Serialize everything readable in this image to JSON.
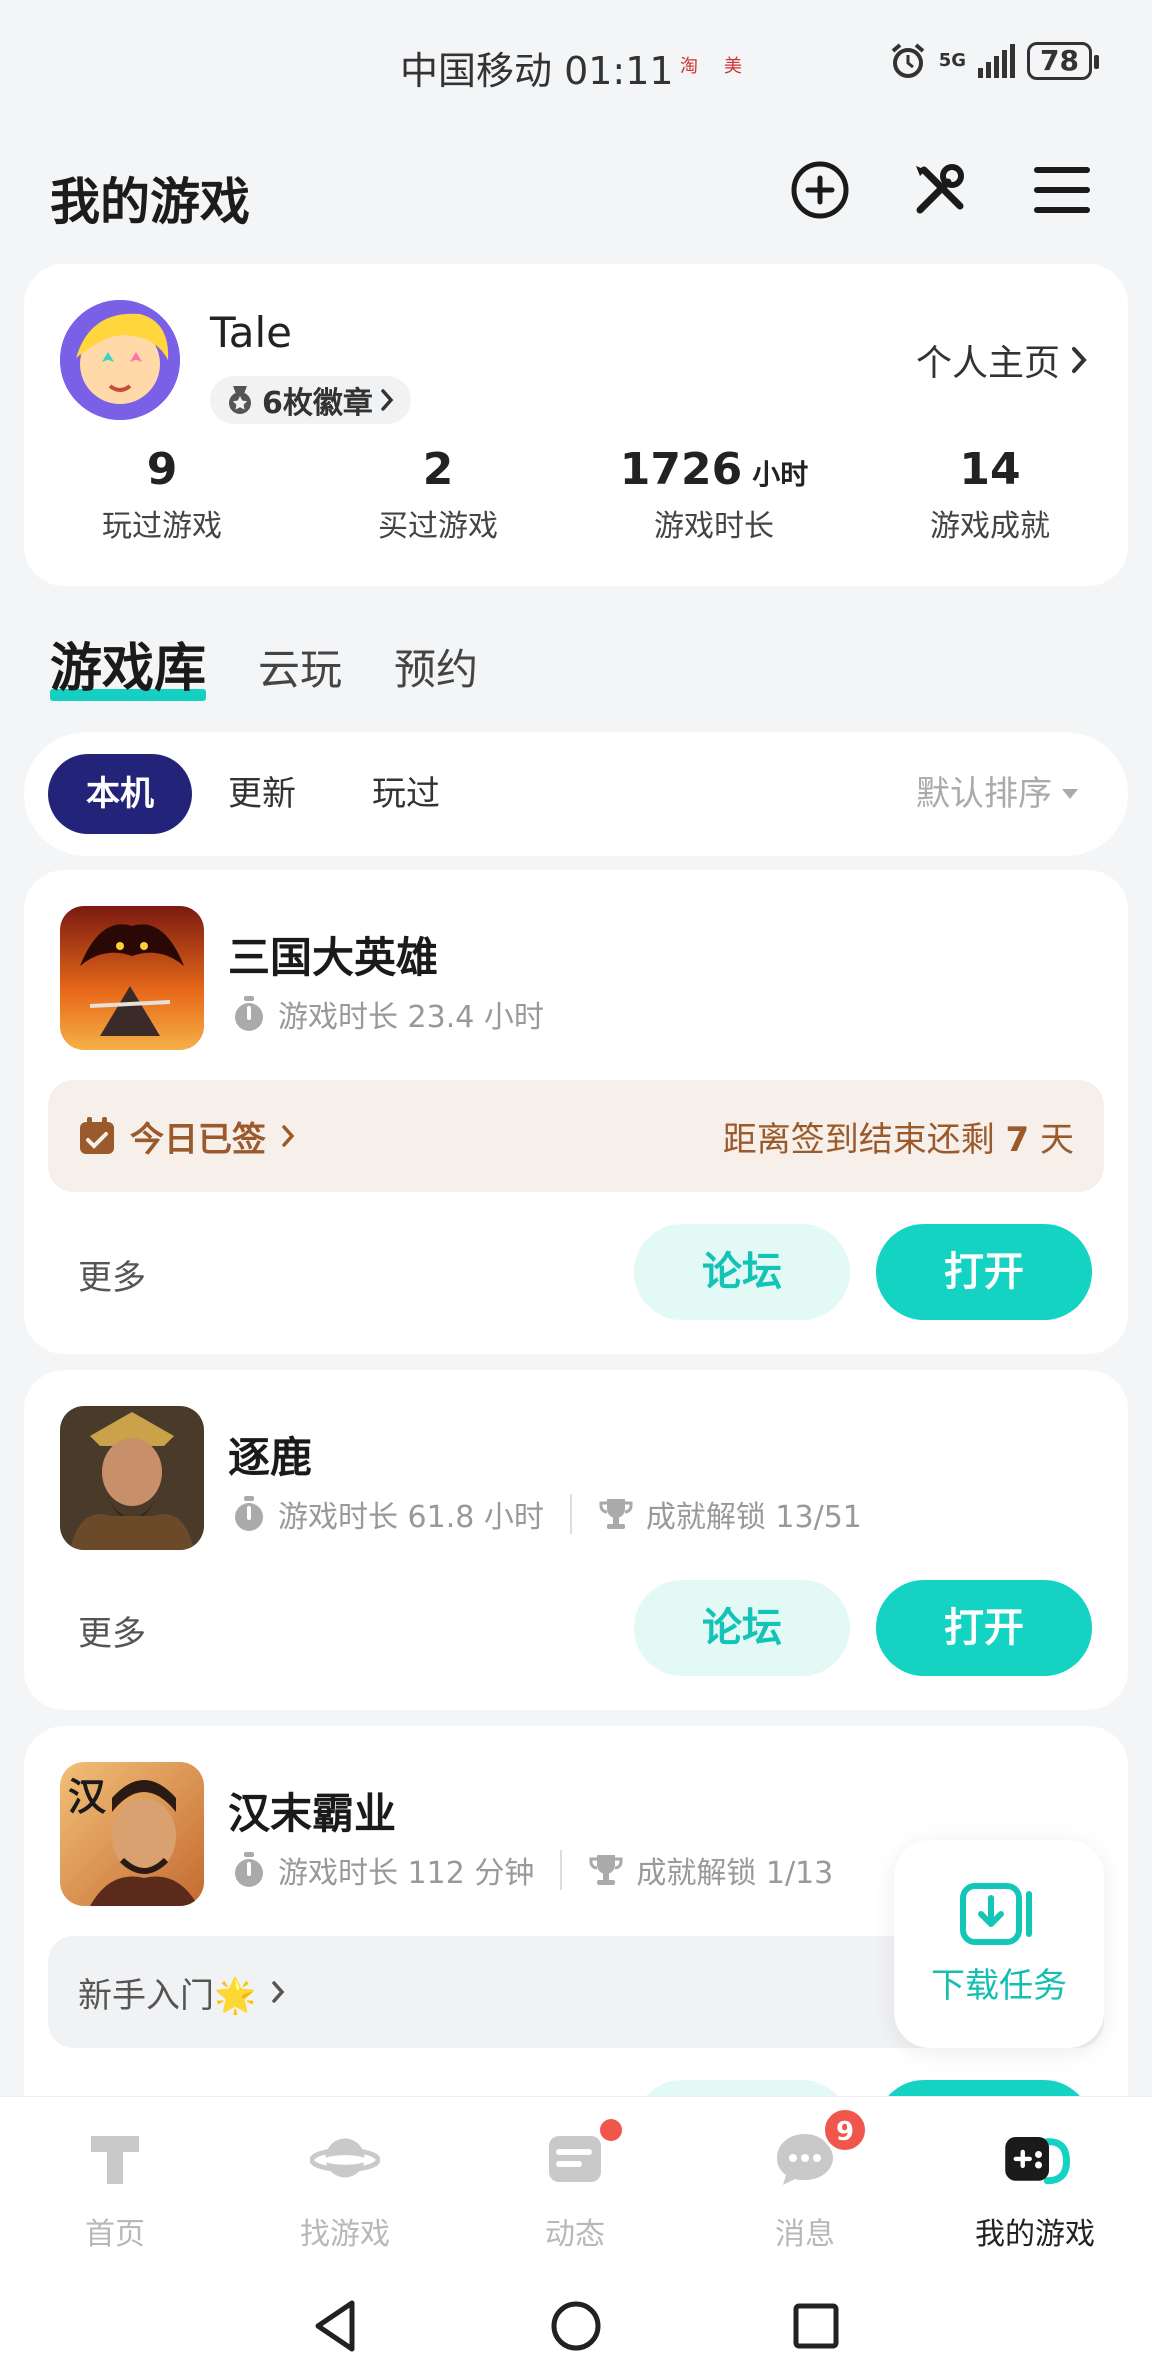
{
  "status_bar": {
    "carrier_time": "中国移动 01:11",
    "notif_1": "淘",
    "notif_2": "美",
    "network": "5G",
    "battery": "78"
  },
  "header": {
    "title": "我的游戏",
    "icons": [
      "add-circle-icon",
      "tools-icon",
      "menu-icon"
    ]
  },
  "profile": {
    "name": "Tale",
    "badges": "6枚徽章",
    "homepage_link": "个人主页",
    "stats": [
      {
        "value": "9",
        "unit": "",
        "label": "玩过游戏"
      },
      {
        "value": "2",
        "unit": "",
        "label": "买过游戏"
      },
      {
        "value": "1726",
        "unit": "小时",
        "label": "游戏时长"
      },
      {
        "value": "14",
        "unit": "",
        "label": "游戏成就"
      }
    ]
  },
  "main_tabs": [
    "游戏库",
    "云玩",
    "预约"
  ],
  "filters": {
    "chips": [
      "本机",
      "更新",
      "玩过"
    ],
    "sort": "默认排序"
  },
  "games": [
    {
      "name": "三国大英雄",
      "playtime": "游戏时长 23.4 小时",
      "achievements": "",
      "banner": {
        "left": "今日已签",
        "right_prefix": "距离签到结束还剩 ",
        "right_num": "7",
        "right_suffix": " 天"
      },
      "more": "更多",
      "forum": "论坛",
      "open": "打开"
    },
    {
      "name": "逐鹿",
      "playtime": "游戏时长 61.8 小时",
      "achievements": "成就解锁 13/51",
      "more": "更多",
      "forum": "论坛",
      "open": "打开"
    },
    {
      "name": "汉末霸业",
      "playtime": "游戏时长 112 分钟",
      "achievements": "成就解锁 1/13",
      "banner": {
        "left": "新手入门🌟"
      },
      "icon_char": "汉"
    }
  ],
  "download_float": {
    "label": "下载任务"
  },
  "bottom_nav": [
    {
      "label": "首页",
      "active": false
    },
    {
      "label": "找游戏",
      "active": false
    },
    {
      "label": "动态",
      "active": false,
      "dot": true
    },
    {
      "label": "消息",
      "active": false,
      "count": "9"
    },
    {
      "label": "我的游戏",
      "active": true
    }
  ],
  "colors": {
    "accent": "#14d3c2",
    "chip_active": "#23237a",
    "checkin_text": "#9b5a2c",
    "badge_red": "#f0564b"
  }
}
